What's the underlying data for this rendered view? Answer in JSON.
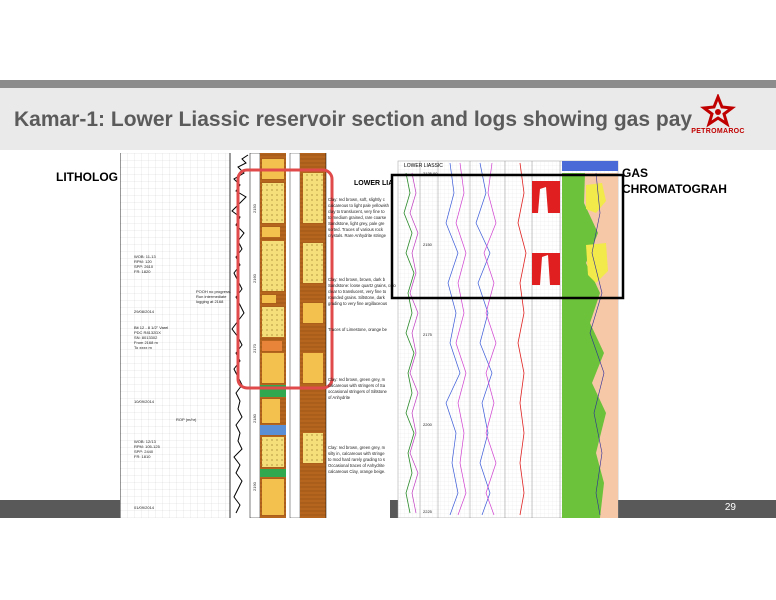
{
  "slide": {
    "title": "Kamar-1: Lower Liassic reservoir section and logs showing gas pay",
    "page_number": "29"
  },
  "logo": {
    "text": "PETROMAROC"
  },
  "labels": {
    "lithology": "LITHOLOG",
    "gas_line1": "GAS",
    "gas_line2": "CHROMATOGRAH"
  },
  "litholog": {
    "header": "LOWER LIA",
    "depth_marks": [
      "2150",
      "2160",
      "2170",
      "2180",
      "2190"
    ],
    "drilling_notes": {
      "block1": [
        "WOB: 11-13",
        "RPM: 120",
        "SPP: 2610",
        "FR: 1820"
      ],
      "pooh": [
        "POOH no progress.",
        "Run intermediate",
        "logging at 2168"
      ],
      "date1": "29/08/2014",
      "block2": [
        "Bit 12 - 8 1/2\" Varel",
        "PDC R8132DX",
        "SN: 8013302",
        "From 2168 m",
        "To xxxx m"
      ],
      "date2": "10/09/2014",
      "col_label": "ROP (m/hr)",
      "block3": [
        "WOB: 12/13",
        "RPM: 105-125",
        "SPP: 2440",
        "FR: 1810"
      ],
      "date3": "01/09/2014"
    },
    "descriptions": {
      "d1": [
        "Clay: red brown, soft, slightly c",
        "calcareous to light pale yellowish",
        "clay to translucent, very fine to",
        "to medium grained, rare coarse",
        "Sandstone, light grey, pale gre",
        "sorted. Traces of various rock",
        "crystals. Rare Anhydrite stringe"
      ],
      "d2": [
        "Clay: red brown, brown, dark b",
        "Sandstone: loose quartz grains, colo",
        "clear to translucent, very fine to",
        "rounded grains. Siltstone, dark",
        "grading to very fine argillaceous"
      ],
      "d3": [
        "Traces of Limestone, orange be"
      ],
      "d4": [
        "Clay: red brown, green grey, m",
        "calcareous with stringers of Sa",
        "occasional stringers of Siltstone",
        "of Anhydrite"
      ],
      "d5": [
        "Clay: red brown, green grey, m",
        "silty in, calcareous with stringe",
        "to mod hard rarely grading to s",
        "Occasional traces of Anhydrite",
        "calcareous Clay, orange beige."
      ]
    }
  },
  "gaslog": {
    "header": "LOWER LIASSIC",
    "top_depth": "2135.00",
    "depth_marks": [
      "2150",
      "2175",
      "2200",
      "2225"
    ]
  }
}
